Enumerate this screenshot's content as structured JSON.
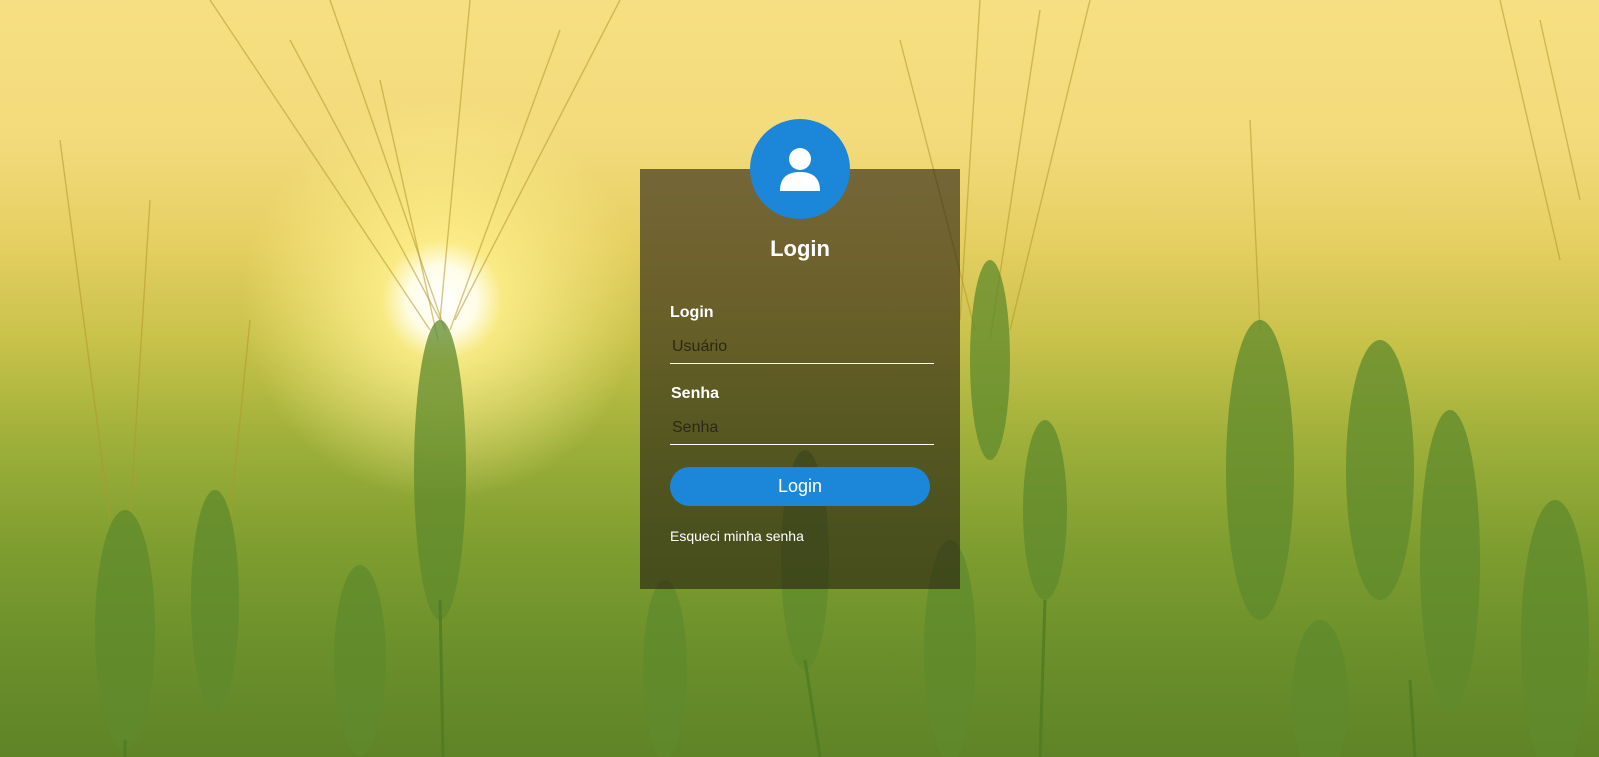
{
  "page": {
    "accent_color": "#1c86d9",
    "card_color": "rgba(40,32,18,0.62)"
  },
  "avatar": {
    "icon": "user-icon"
  },
  "form": {
    "title": "Login",
    "login_label": "Login",
    "login_placeholder": "Usuário",
    "login_value": "",
    "password_label": "Senha",
    "password_placeholder": "Senha",
    "password_value": "",
    "submit_label": "Login",
    "forgot_link": "Esqueci minha senha"
  }
}
